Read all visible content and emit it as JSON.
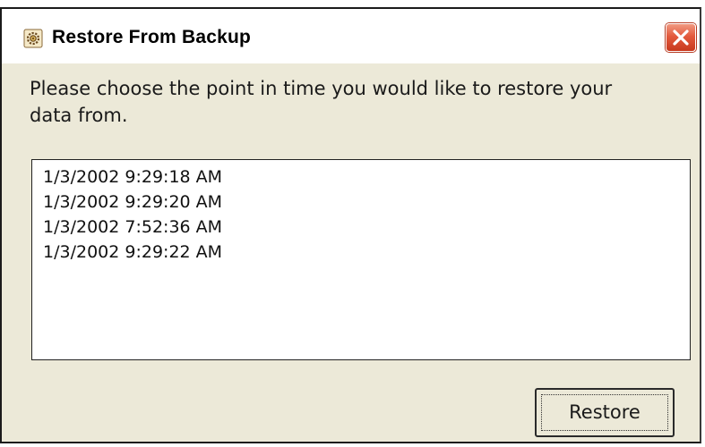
{
  "window": {
    "title": "Restore From Backup"
  },
  "prompt": {
    "text": "Please choose the point in time you would like to restore your data from."
  },
  "restore_points": [
    "1/3/2002 9:29:18 AM",
    "1/3/2002 9:29:20 AM",
    "1/3/2002 7:52:36 AM",
    "1/3/2002 9:29:22 AM"
  ],
  "buttons": {
    "restore_label": "Restore"
  },
  "colors": {
    "dialog_background": "#ece9d8",
    "close_button": "#e35a3d"
  },
  "icons": {
    "title": "gear-settings-icon",
    "close": "close-icon"
  }
}
